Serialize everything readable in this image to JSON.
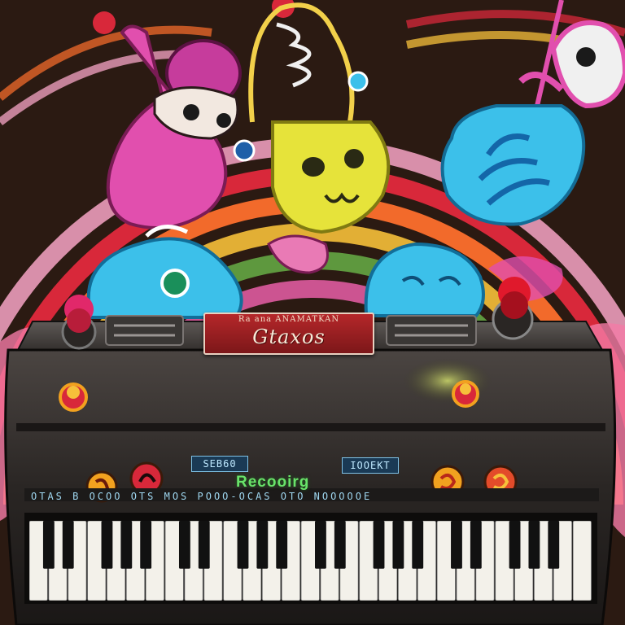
{
  "scene": {
    "colors": {
      "background": "#2b1a12",
      "rainbow": [
        "#d8283a",
        "#f26a2b",
        "#f6c03a",
        "#6bb84a",
        "#e95fa8",
        "#f7a5c6"
      ],
      "synth_body": "#2a2624",
      "key_white": "#f3f1ea",
      "key_black": "#111111",
      "character_pink": "#e14fae",
      "character_yellow": "#e6e33a",
      "character_blue": "#3cc0ea"
    },
    "characters": [
      "pink-guitar-creature",
      "yellow-lantern-creature",
      "blue-shield-creature",
      "blue-blob-creature-left",
      "blue-blob-creature-right",
      "pink-swirl-creature-top-right"
    ],
    "synth": {
      "plate_top_text": "Ra ana ANAMATKAN",
      "plate_main_text": "Gtaxos",
      "display_left": "SEB60",
      "display_right": "IOOEKT",
      "record_label": "Recooirg",
      "panel_strip_text": "OTAS  B OCOO  OTS MOS POOO-OCAS  OTO NOOOOOE",
      "knob_colors": [
        "#f2a11f",
        "#d8283a",
        "#f2a11f",
        "#e34b2a"
      ],
      "white_key_count": 29
    }
  }
}
